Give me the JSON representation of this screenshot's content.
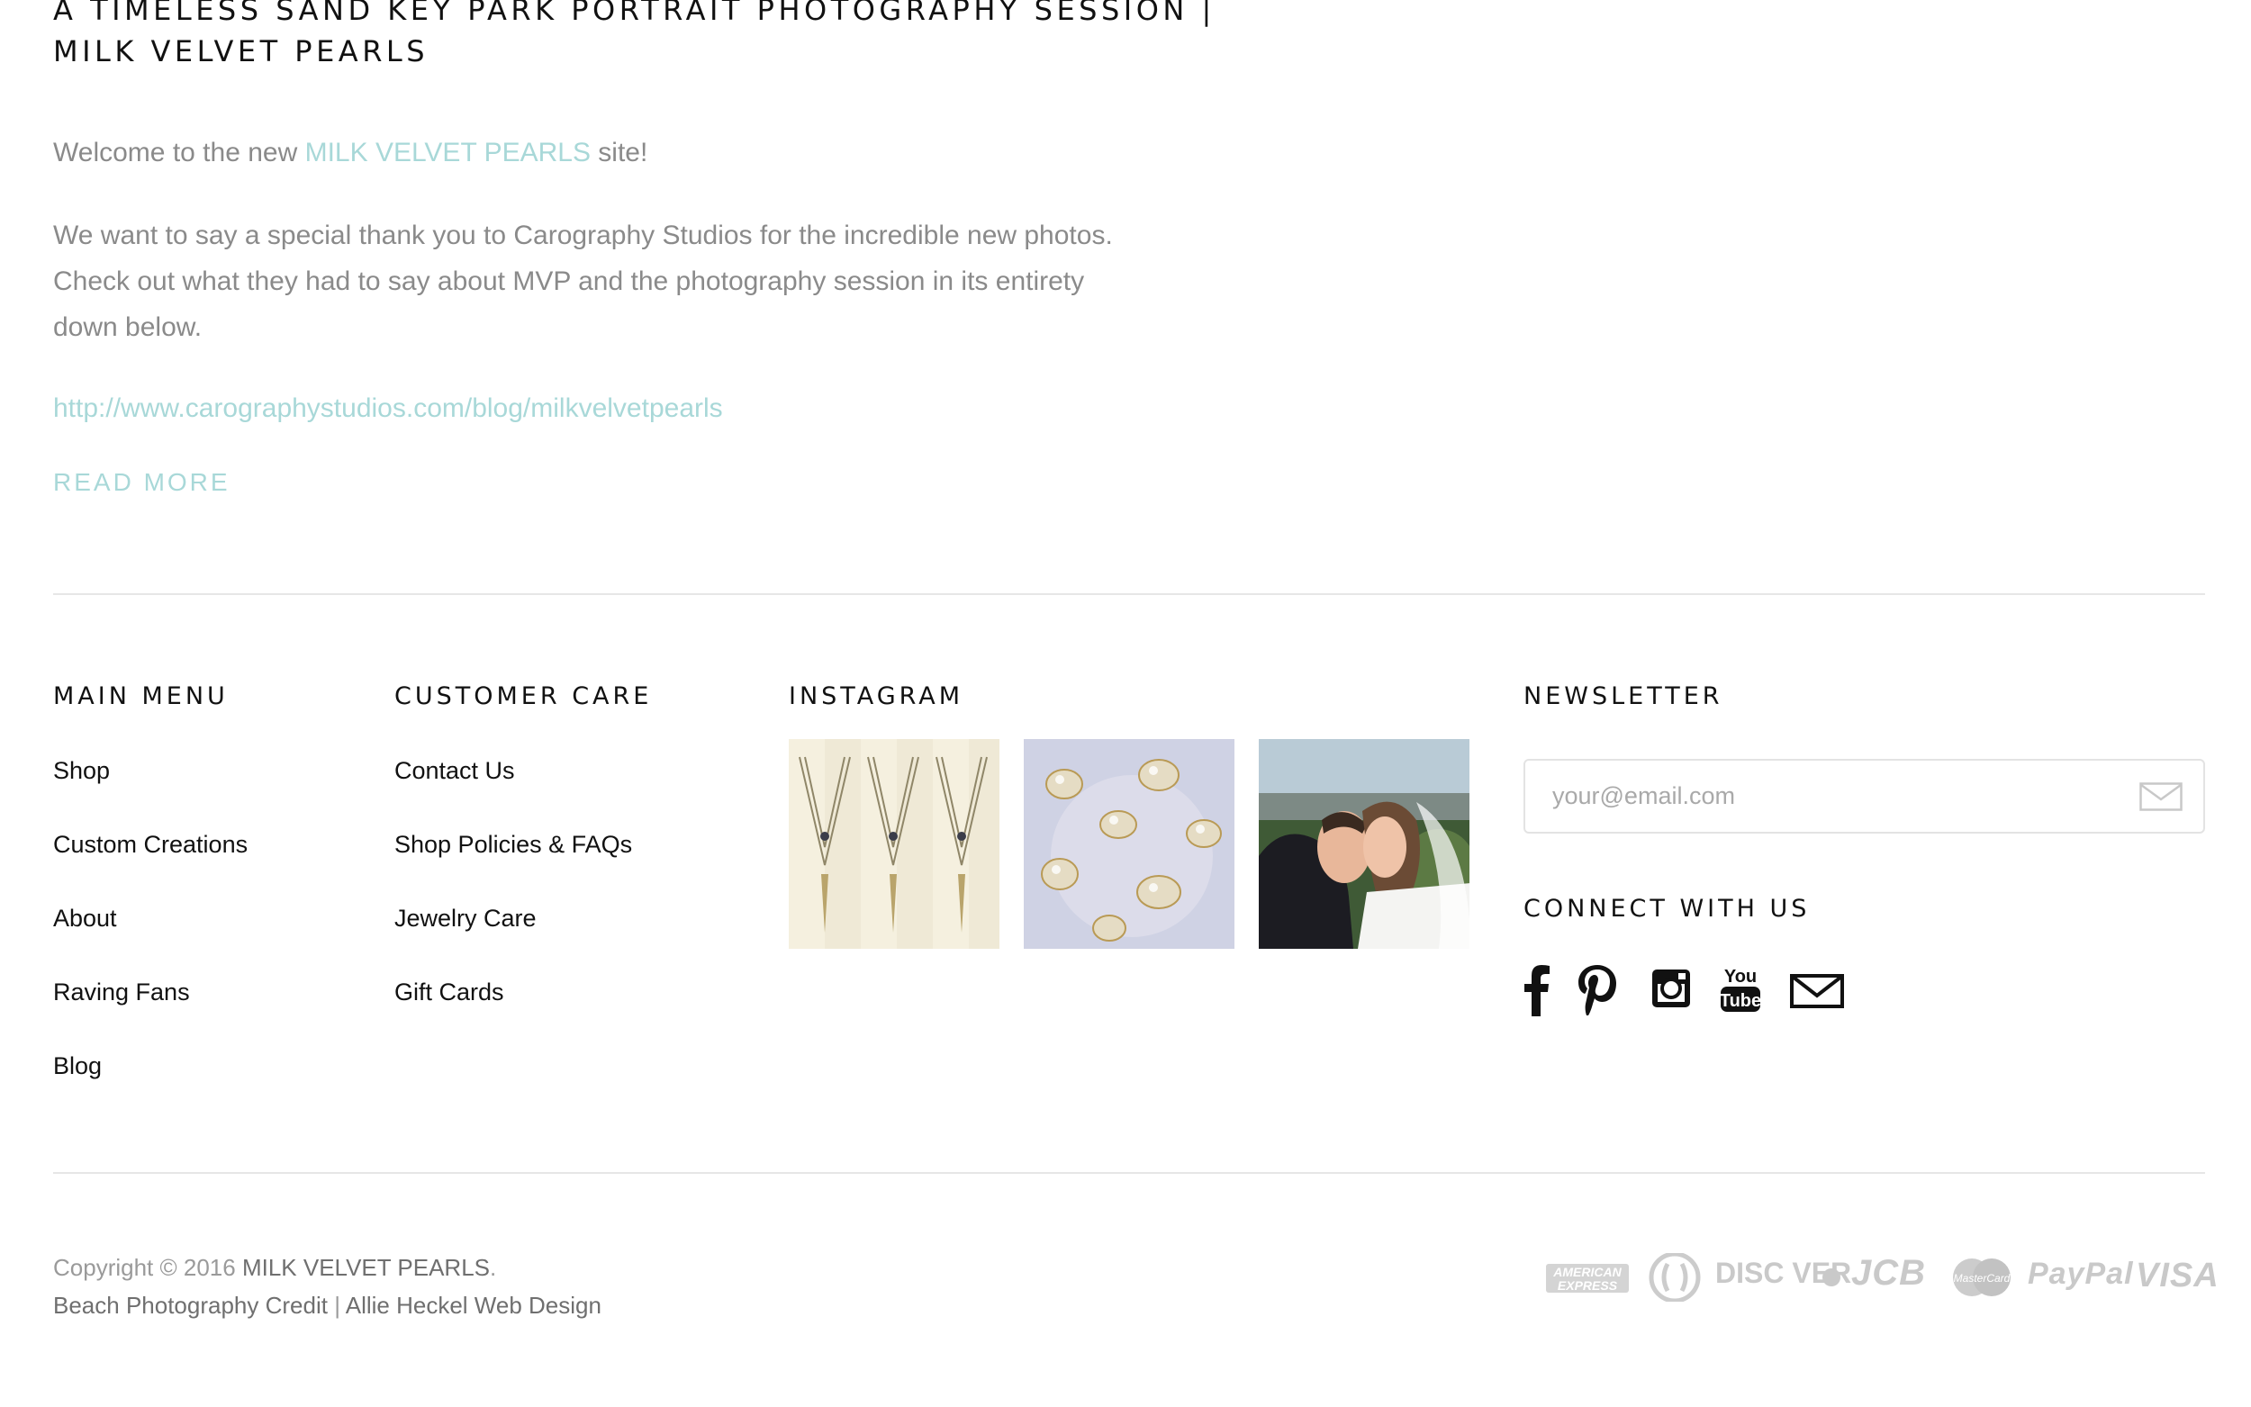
{
  "post": {
    "title_line1": "A TIMELESS SAND KEY PARK PORTRAIT PHOTOGRAPHY SESSION |",
    "title_line2": "MILK VELVET PEARLS",
    "welcome_prefix": "Welcome to the new ",
    "welcome_brand": "MILK VELVET PEARLS",
    "welcome_suffix": " site!",
    "thanks": "We want to say a special thank you to Carography Studios for the incredible new photos. Check out what they had to say about MVP and the photography session in its entirety down below.",
    "link": "http://www.carographystudios.com/blog/milkvelvetpearls",
    "read_more": "READ MORE"
  },
  "footer": {
    "main_menu": {
      "heading": "MAIN MENU",
      "items": [
        "Shop",
        "Custom Creations",
        "About",
        "Raving Fans",
        "Blog"
      ]
    },
    "customer_care": {
      "heading": "CUSTOMER CARE",
      "items": [
        "Contact Us",
        "Shop Policies & FAQs",
        "Jewelry Care",
        "Gift Cards"
      ]
    },
    "instagram": {
      "heading": "INSTAGRAM",
      "photos": [
        "necklace-photo",
        "pearls-photo",
        "wedding-kiss-photo"
      ]
    },
    "newsletter": {
      "heading": "NEWSLETTER",
      "placeholder": "your@email.com",
      "connect_heading": "CONNECT WITH US",
      "social_icons": [
        "facebook-icon",
        "pinterest-icon",
        "instagram-icon",
        "youtube-icon",
        "email-icon"
      ],
      "youtube_text_top": "You",
      "youtube_text_bottom": "Tube"
    },
    "copyright": {
      "prefix": "Copyright © 2016 ",
      "brand": "MILK VELVET PEARLS",
      "suffix": ".",
      "credit_line": "Beach Photography Credit",
      "separator": " | ",
      "design_credit": "Allie Heckel Web Design"
    },
    "payments": {
      "amex_top": "AMERICAN",
      "amex_bottom": "EXPRESS",
      "discover": "DISC    VER",
      "jcb": "JCB",
      "mastercard": "MasterCard",
      "paypal": "PayPal",
      "visa": "VISA"
    },
    "colors": {
      "accent": "#a8d8d8",
      "muted_text": "#8a8a8a",
      "divider": "#e6e6e6"
    }
  }
}
